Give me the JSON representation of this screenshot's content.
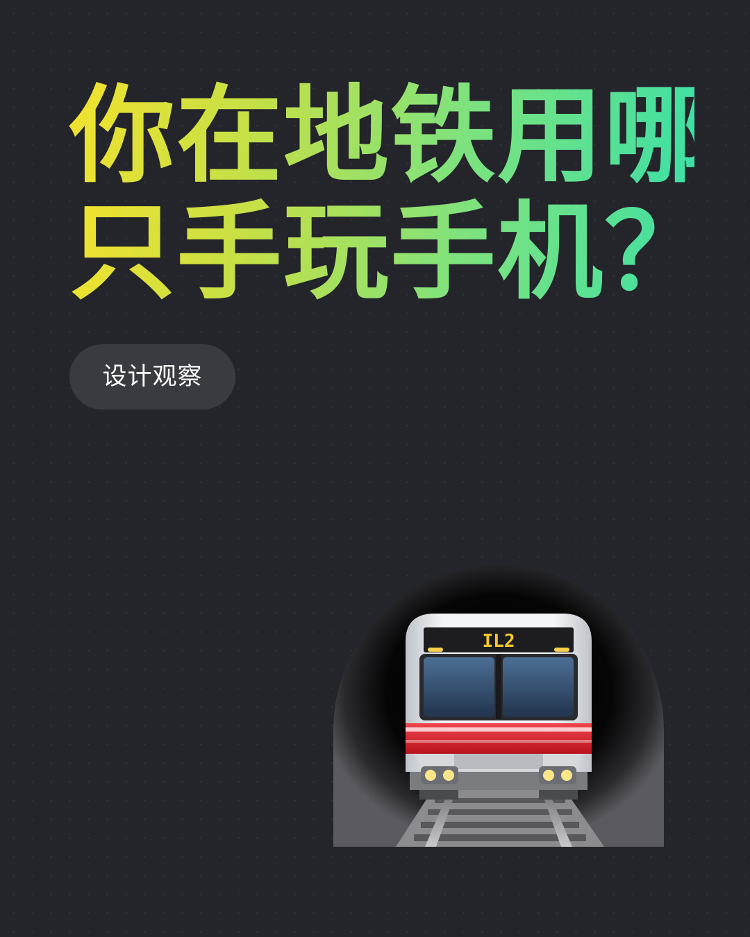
{
  "headline": {
    "line1": "你在地铁用哪",
    "line2": "只手玩手机？",
    "gradient_colors": [
      "#f2e22e",
      "#c4e047",
      "#7fe27d",
      "#3de0a5"
    ]
  },
  "tag": {
    "label": "设计观察"
  },
  "illustration": {
    "icon": "metro-train-icon",
    "display_text": "IL2",
    "stripe_color": "#e0232e"
  },
  "background_color": "#24242b"
}
